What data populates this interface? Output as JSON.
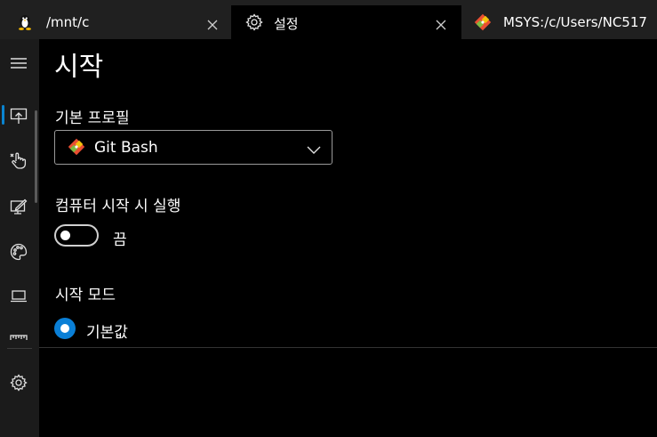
{
  "tabs": [
    {
      "title": "/mnt/c",
      "icon": "linux-penguin-icon",
      "active": false,
      "closable": true
    },
    {
      "title": "설정",
      "icon": "gear-icon",
      "active": true,
      "closable": true
    },
    {
      "title": "MSYS:/c/Users/NC517",
      "icon": "git-icon",
      "active": false,
      "closable": false
    }
  ],
  "nav": {
    "items": [
      {
        "name": "menu",
        "icon": "hamburger-icon"
      },
      {
        "name": "startup",
        "icon": "monitor-arrow-icon",
        "selected": true
      },
      {
        "name": "interaction",
        "icon": "hand-pointer-icon"
      },
      {
        "name": "rendering",
        "icon": "display-pen-icon"
      },
      {
        "name": "appearance",
        "icon": "palette-icon"
      },
      {
        "name": "terminal",
        "icon": "laptop-icon"
      },
      {
        "name": "keyboard",
        "icon": "ruler-icon"
      },
      {
        "name": "settings",
        "icon": "gear-icon"
      }
    ]
  },
  "page": {
    "title": "시작",
    "default_profile_label": "기본 프로필",
    "default_profile_value": "Git Bash",
    "startup_label": "컴퓨터 시작 시 실행",
    "startup_state": "끔",
    "startup_enabled": false,
    "launch_mode_label": "시작 모드",
    "launch_mode_value": "기본값"
  },
  "colors": {
    "accent": "#0a7fd6",
    "tabbar_bg": "#202020",
    "nav_bg": "#1b1b1b",
    "content_bg": "#000000"
  }
}
